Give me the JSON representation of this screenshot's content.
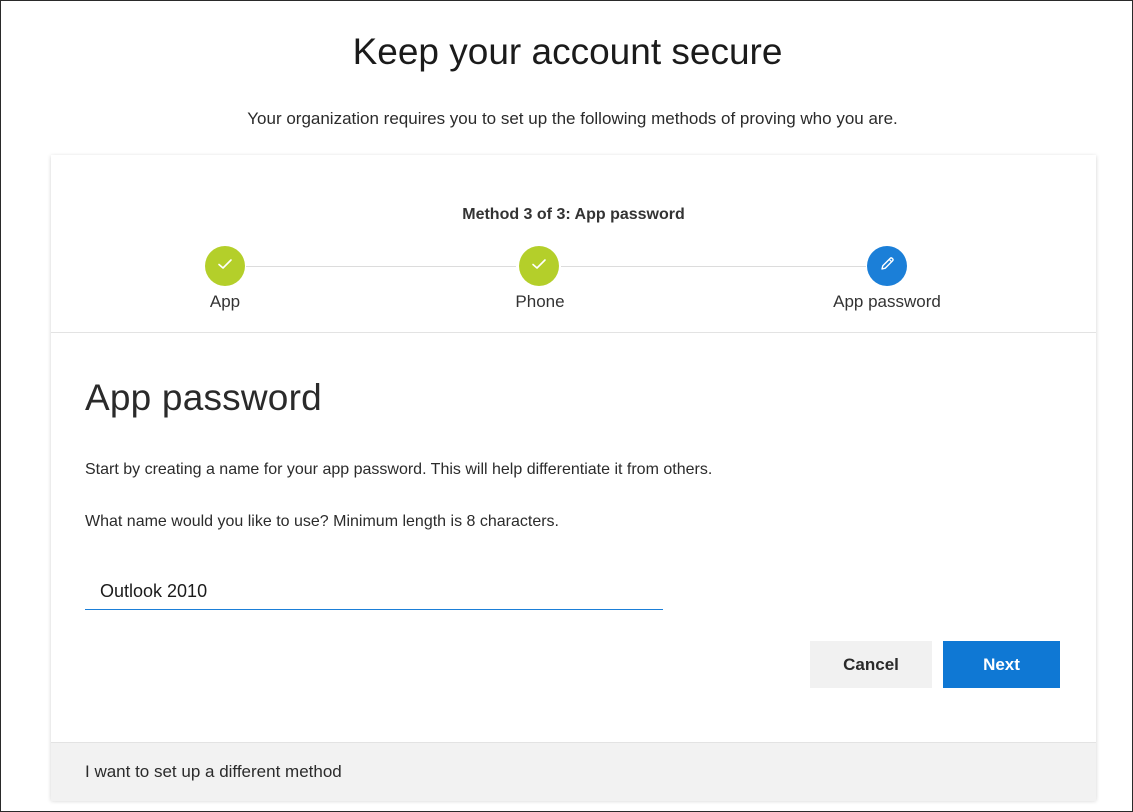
{
  "page": {
    "title": "Keep your account secure",
    "subtitle": "Your organization requires you to set up the following methods of proving who you are."
  },
  "progress": {
    "method_label": "Method 3 of 3: App password",
    "steps": [
      {
        "label": "App",
        "state": "done",
        "icon": "check-icon"
      },
      {
        "label": "Phone",
        "state": "done",
        "icon": "check-icon"
      },
      {
        "label": "App password",
        "state": "current",
        "icon": "pencil-icon"
      }
    ]
  },
  "form": {
    "section_title": "App password",
    "intro_text": "Start by creating a name for your app password. This will help differentiate it from others.",
    "name_label": "What name would you like to use? Minimum length is 8 characters.",
    "name_value": "Outlook 2010"
  },
  "buttons": {
    "cancel_label": "Cancel",
    "next_label": "Next"
  },
  "footer": {
    "link_text": "I want to set up a different method"
  },
  "colors": {
    "done_step": "#b4cf2a",
    "current_step": "#1b7fd8",
    "primary_button": "#0f78d4",
    "secondary_button": "#f1f1f1",
    "footer_background": "#f2f2f2"
  }
}
